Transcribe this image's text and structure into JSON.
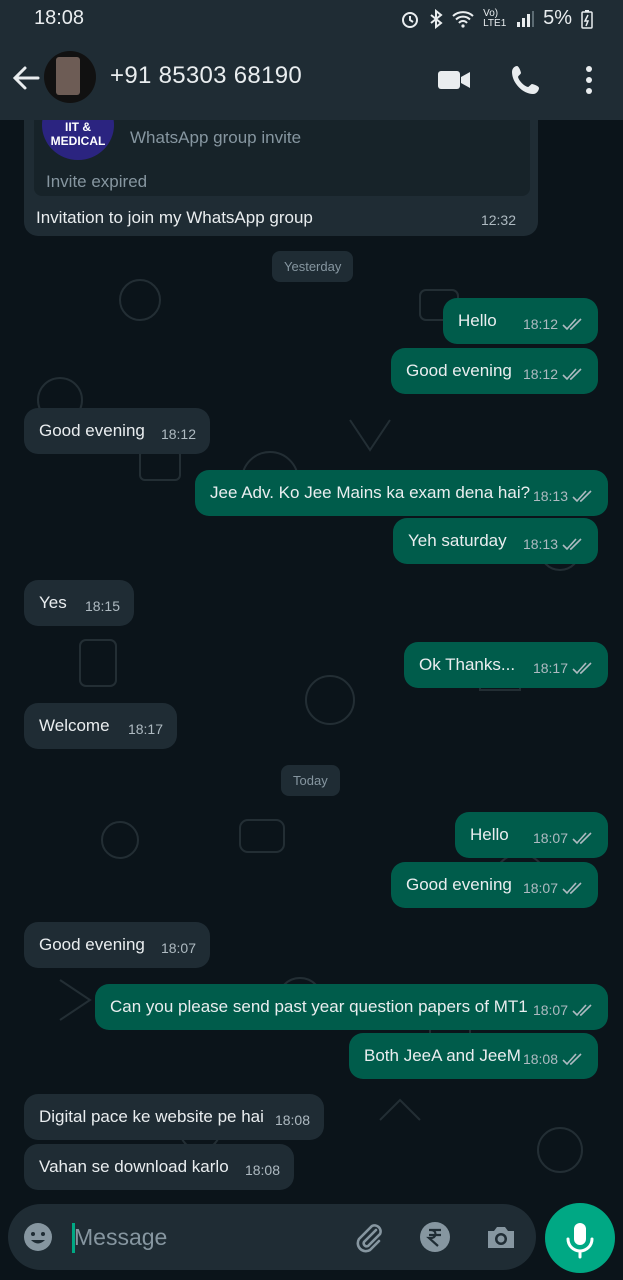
{
  "status_bar": {
    "time": "18:08",
    "network": "Vo) LTE1",
    "battery": "5%"
  },
  "header": {
    "contact": "+91 85303 68190"
  },
  "invite": {
    "logo_text": "IIT & MEDICAL",
    "type_label": "WhatsApp group invite",
    "status": "Invite expired",
    "message": "Invitation to join my WhatsApp group",
    "time": "12:32"
  },
  "day_labels": {
    "yesterday": "Yesterday",
    "today": "Today"
  },
  "messages": [
    {
      "dir": "out",
      "text": "Hello",
      "time": "18:12"
    },
    {
      "dir": "out",
      "text": "Good evening",
      "time": "18:12"
    },
    {
      "dir": "in",
      "text": "Good evening",
      "time": "18:12"
    },
    {
      "dir": "out",
      "text": "Jee Adv. Ko Jee Mains ka exam dena hai?",
      "time": "18:13"
    },
    {
      "dir": "out",
      "text": "Yeh saturday",
      "time": "18:13"
    },
    {
      "dir": "in",
      "text": "Yes",
      "time": "18:15"
    },
    {
      "dir": "out",
      "text": "Ok Thanks...",
      "time": "18:17"
    },
    {
      "dir": "in",
      "text": "Welcome",
      "time": "18:17"
    },
    {
      "dir": "out",
      "text": "Hello",
      "time": "18:07"
    },
    {
      "dir": "out",
      "text": "Good evening",
      "time": "18:07"
    },
    {
      "dir": "in",
      "text": "Good evening",
      "time": "18:07"
    },
    {
      "dir": "out",
      "text": "Can you please send past year question papers of MT1",
      "time": "18:07"
    },
    {
      "dir": "out",
      "text": "Both JeeA and JeeM",
      "time": "18:08"
    },
    {
      "dir": "in",
      "text": "Digital pace ke website pe hai",
      "time": "18:08"
    },
    {
      "dir": "in",
      "text": "Vahan se download karlo",
      "time": "18:08"
    }
  ],
  "composer": {
    "placeholder": "Message"
  },
  "icons": {
    "back": "arrow-left-icon",
    "video": "video-call-icon",
    "call": "phone-icon",
    "menu": "more-vert-icon",
    "emoji": "emoji-icon",
    "attach": "paperclip-icon",
    "payment": "rupee-icon",
    "camera": "camera-icon",
    "mic": "mic-icon"
  },
  "colors": {
    "incoming": "#1f2c34",
    "outgoing": "#005c4b",
    "accent": "#00a884",
    "background": "#0b141a",
    "read_ticks": "#aebac1"
  }
}
